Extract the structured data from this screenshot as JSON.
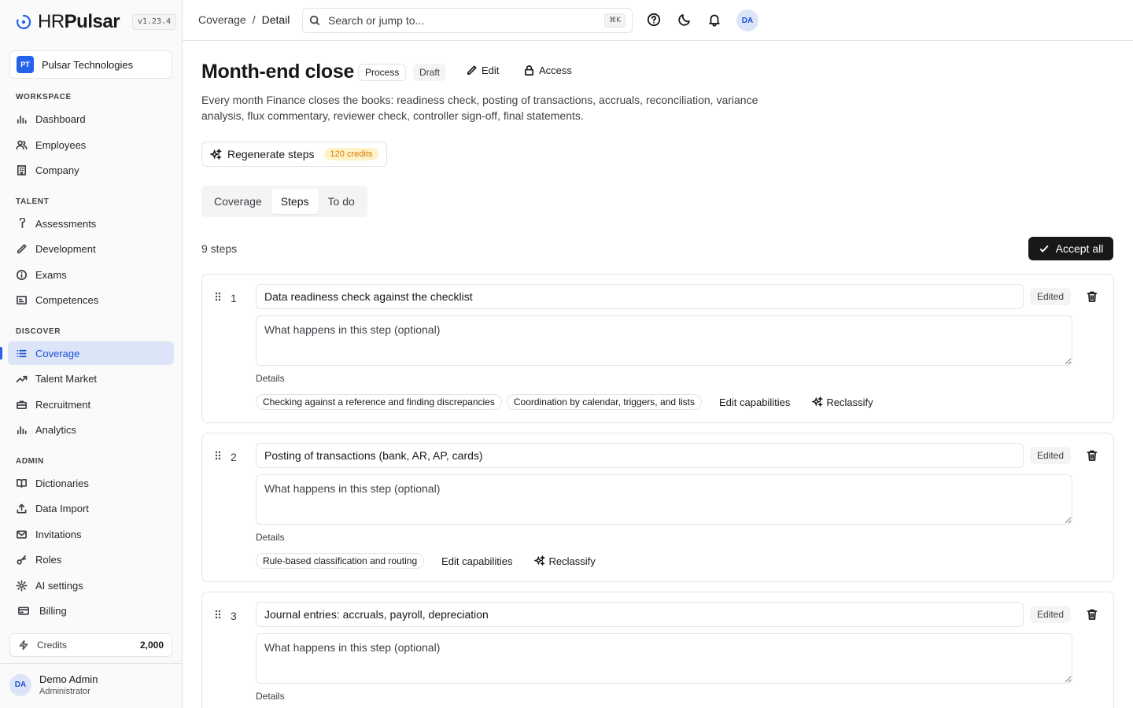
{
  "brand": {
    "hr": "HR",
    "name": "Pulsar",
    "version": "v1.23.4"
  },
  "org": {
    "initials": "PT",
    "name": "Pulsar Technologies"
  },
  "sidebar": {
    "sections": [
      {
        "title": "WORKSPACE",
        "items": [
          "Dashboard",
          "Employees",
          "Company"
        ]
      },
      {
        "title": "TALENT",
        "items": [
          "Assessments",
          "Development",
          "Exams",
          "Competences"
        ]
      },
      {
        "title": "DISCOVER",
        "items": [
          "Coverage",
          "Talent Market",
          "Recruitment",
          "Analytics"
        ]
      },
      {
        "title": "ADMIN",
        "items": [
          "Dictionaries",
          "Data Import",
          "Invitations",
          "Roles",
          "AI settings",
          "Billing"
        ]
      }
    ],
    "active": "Coverage"
  },
  "credits": {
    "label": "Credits",
    "value": "2,000"
  },
  "user": {
    "initials": "DA",
    "name": "Demo Admin",
    "role": "Administrator"
  },
  "topbar": {
    "breadcrumb": [
      "Coverage",
      "Detail"
    ],
    "search_placeholder": "Search or jump to...",
    "search_shortcut": "⌘K",
    "avatar": "DA"
  },
  "page": {
    "title": "Month-end close",
    "badge_type": "Process",
    "badge_status": "Draft",
    "edit_label": "Edit",
    "access_label": "Access",
    "description": "Every month Finance closes the books: readiness check, posting of transactions, accruals, reconciliation, variance analysis, flux commentary, reviewer check, controller sign-off, final statements.",
    "regenerate_label": "Regenerate steps",
    "regenerate_credits": "120 credits",
    "tabs": [
      "Coverage",
      "Steps",
      "To do"
    ],
    "active_tab": "Steps",
    "steps_count": "9 steps",
    "accept_all_label": "Accept all"
  },
  "step_common": {
    "edited_label": "Edited",
    "desc_placeholder": "What happens in this step (optional)",
    "details_label": "Details",
    "edit_capabilities_label": "Edit capabilities",
    "reclassify_label": "Reclassify"
  },
  "steps": [
    {
      "number": "1",
      "title": "Data readiness check against the checklist",
      "capabilities": [
        "Checking against a reference and finding discrepancies",
        "Coordination by calendar, triggers, and lists"
      ]
    },
    {
      "number": "2",
      "title": "Posting of transactions (bank, AR, AP, cards)",
      "capabilities": [
        "Rule-based classification and routing"
      ]
    },
    {
      "number": "3",
      "title": "Journal entries: accruals, payroll, depreciation",
      "capabilities": []
    }
  ]
}
